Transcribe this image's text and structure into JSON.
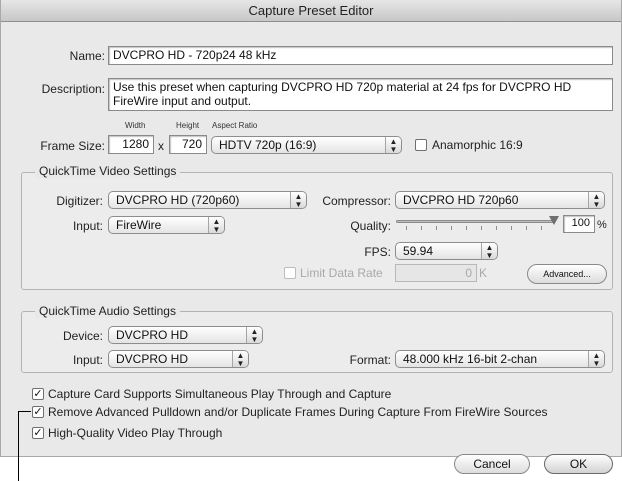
{
  "window": {
    "title": "Capture Preset Editor"
  },
  "name": {
    "label": "Name:",
    "value": "DVCPRO HD - 720p24 48 kHz"
  },
  "description": {
    "label": "Description:",
    "line1": "Use this preset when capturing DVCPRO HD 720p material at 24 fps for DVCPRO HD",
    "line2": "FireWire input and output."
  },
  "frame_size": {
    "label": "Frame Size:",
    "width_label": "Width",
    "height_label": "Height",
    "aspect_label": "Aspect Ratio",
    "width": "1280",
    "times": "x",
    "height": "720",
    "aspect": "HDTV 720p (16:9)",
    "anamorphic_label": "Anamorphic 16:9",
    "anamorphic_checked": false
  },
  "video": {
    "title": "QuickTime Video Settings",
    "digitizer_label": "Digitizer:",
    "digitizer": "DVCPRO HD (720p60)",
    "compressor_label": "Compressor:",
    "compressor": "DVCPRO HD 720p60",
    "input_label": "Input:",
    "input": "FireWire",
    "quality_label": "Quality:",
    "quality_value": "100",
    "quality_unit": "%",
    "quality_fraction": 1.0,
    "fps_label": "FPS:",
    "fps": "59.94",
    "limit_label": "Limit Data Rate",
    "limit_checked": false,
    "limit_value": "0",
    "limit_unit": "K",
    "advanced_label": "Advanced..."
  },
  "audio": {
    "title": "QuickTime Audio Settings",
    "device_label": "Device:",
    "device": "DVCPRO HD",
    "input_label": "Input:",
    "input": "DVCPRO HD",
    "format_label": "Format:",
    "format": "48.000 kHz 16-bit 2-chan"
  },
  "options": [
    {
      "label": "Capture Card Supports Simultaneous Play Through and Capture",
      "checked": true
    },
    {
      "label": "Remove Advanced Pulldown and/or Duplicate Frames During Capture From FireWire Sources",
      "checked": true
    },
    {
      "label": "High-Quality Video Play Through",
      "checked": true
    }
  ],
  "buttons": {
    "cancel": "Cancel",
    "ok": "OK"
  },
  "icons": {
    "popup_arrows": "updown-arrows-icon",
    "checkmark": "checkmark-icon"
  }
}
